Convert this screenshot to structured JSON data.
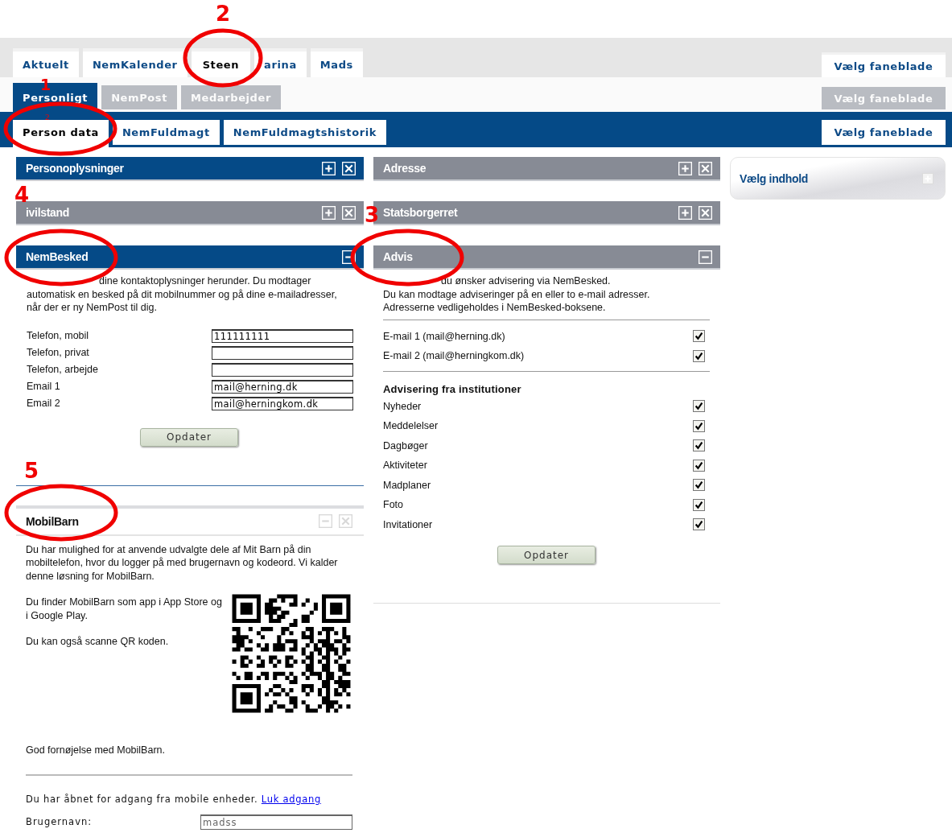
{
  "main_tabs": {
    "tabs": [
      {
        "label": "Aktuelt",
        "selected": false
      },
      {
        "label": "NemKalender",
        "selected": false
      },
      {
        "label": "Steen",
        "selected": true
      },
      {
        "label": "arina",
        "selected": false
      },
      {
        "label": "Mads",
        "selected": false
      }
    ],
    "chooser": {
      "label": "Vælg faneblade",
      "disabled": false
    }
  },
  "section_tabs": {
    "tabs": [
      {
        "label": "Personligt",
        "selected": true,
        "disabled": false
      },
      {
        "label": "NemPost",
        "selected": false,
        "disabled": true
      },
      {
        "label": "Medarbejder",
        "selected": false,
        "disabled": true
      }
    ],
    "chooser": {
      "label": "Vælg faneblade",
      "disabled": true
    }
  },
  "sub_tabs": {
    "tabs": [
      {
        "label": "Person data",
        "selected": true
      },
      {
        "label": "NemFuldmagt",
        "selected": false
      },
      {
        "label": "NemFuldmagtshistorik",
        "selected": false
      }
    ],
    "chooser": {
      "label": "Vælg faneblade",
      "disabled": false
    }
  },
  "left_column": [
    {
      "kind": "collapsed",
      "title": "Personoplysninger",
      "selected": true
    },
    {
      "kind": "collapsed",
      "title": "ivilstand",
      "selected": false
    },
    {
      "kind": "contact_form",
      "title": "NemBesked",
      "selected": true,
      "intro": "dine kontaktoplysninger herunder. Du modtager automatisk en besked på dit mobilnummer og på dine e-mailadresser, når der er ny NemPost til dig.",
      "fields": [
        {
          "label": "Telefon, mobil",
          "value": "111111111"
        },
        {
          "label": "Telefon, privat"
        },
        {
          "label": "Telefon, arbejde"
        },
        {
          "label": "Email 1",
          "value": "mail@herning.dk"
        },
        {
          "label": "Email 2",
          "value": "mail@herningkom.dk"
        }
      ],
      "button": "Opdater"
    },
    {
      "kind": "mobile_access",
      "title": "MobilBarn",
      "intro": "Du har mulighed for at anvende udvalgte dele af Mit Barn på din mobiltelefon, hvor du logger på med brugernavn og kodeord. Vi kalder denne løsning for MobilBarn.",
      "store_text": "Du finder MobilBarn som app i App Store og i Google Play.",
      "scan_text": "Du kan også scanne QR koden.",
      "closing": "God fornøjelse med MobilBarn.",
      "access_text": "Du har åbnet for adgang fra mobile enheder.",
      "access_link": "Luk adgang",
      "username": {
        "label": "Brugernavn:",
        "value": "madss",
        "disabled": true
      }
    }
  ],
  "middle_column": [
    {
      "kind": "collapsed",
      "title": "Adresse",
      "selected": false
    },
    {
      "kind": "collapsed",
      "title": "Statsborgerret",
      "selected": false
    },
    {
      "kind": "notifications",
      "title": "Advis",
      "selected": false,
      "intro": [
        "du ønsker advisering via NemBesked.",
        "Du kan modtage adviseringer på en eller to e-mail adresser.",
        "Adresserne vedligeholdes i NemBesked-boksene."
      ],
      "emails": [
        {
          "label": "E-mail 1 (mail@herning.dk)",
          "checked": true
        },
        {
          "label": "E-mail 2 (mail@herningkom.dk)",
          "checked": true
        }
      ],
      "institutions_heading": "Advisering fra institutioner",
      "institutions": [
        {
          "label": "Nyheder",
          "checked": true
        },
        {
          "label": "Meddelelser",
          "checked": true
        },
        {
          "label": "Dagbøger",
          "checked": true
        },
        {
          "label": "Aktiviteter",
          "checked": true
        },
        {
          "label": "Madplaner",
          "checked": true
        },
        {
          "label": "Foto",
          "checked": true
        },
        {
          "label": "Invitationer",
          "checked": true
        }
      ],
      "button": "Opdater"
    }
  ],
  "sidebar_widget": {
    "title": "Vælg indhold"
  },
  "annotations": [
    {
      "label": "1",
      "small_mark": "2"
    },
    {
      "label": "2"
    },
    {
      "label": "3"
    },
    {
      "label": "4"
    },
    {
      "label": "5"
    }
  ]
}
